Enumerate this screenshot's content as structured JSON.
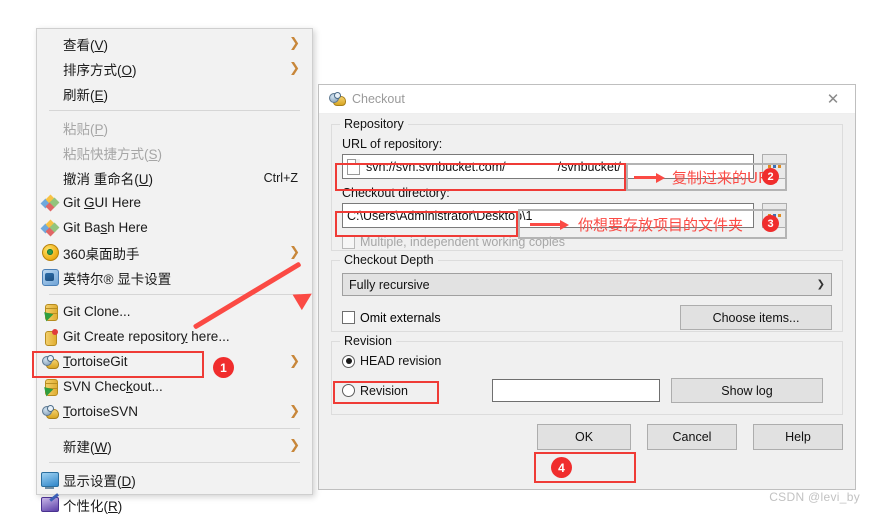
{
  "context_menu": {
    "items": [
      {
        "label": "查看(V)",
        "accel": "",
        "icon": "none",
        "submenu": true,
        "disabled": false,
        "key": "V"
      },
      {
        "label": "排序方式(O)",
        "accel": "",
        "icon": "none",
        "submenu": true,
        "disabled": false,
        "key": "O"
      },
      {
        "label": "刷新(E)",
        "accel": "",
        "icon": "none",
        "submenu": false,
        "disabled": false,
        "key": "E"
      },
      {
        "separator": true
      },
      {
        "label": "粘贴(P)",
        "accel": "",
        "icon": "none",
        "submenu": false,
        "disabled": true,
        "key": "P"
      },
      {
        "label": "粘贴快捷方式(S)",
        "accel": "",
        "icon": "none",
        "submenu": false,
        "disabled": true,
        "key": "S"
      },
      {
        "label": "撤消 重命名(U)",
        "accel": "Ctrl+Z",
        "icon": "none",
        "submenu": false,
        "disabled": false,
        "key": "U"
      },
      {
        "label": "Git GUI Here",
        "accel": "",
        "icon": "git-diamonds-icon",
        "submenu": false,
        "disabled": false,
        "key": "G"
      },
      {
        "label": "Git Bash Here",
        "accel": "",
        "icon": "git-diamonds-icon",
        "submenu": false,
        "disabled": false,
        "key": "s"
      },
      {
        "label": "360桌面助手",
        "accel": "",
        "icon": "360-assistant-icon",
        "submenu": true,
        "disabled": false,
        "key": ""
      },
      {
        "label": "英特尔® 显卡设置",
        "accel": "",
        "icon": "intel-graphics-icon",
        "submenu": false,
        "disabled": false,
        "key": ""
      },
      {
        "separator": true
      },
      {
        "label": "Git Clone...",
        "accel": "",
        "icon": "git-clone-icon",
        "submenu": false,
        "disabled": false,
        "key": ""
      },
      {
        "label": "Git Create repository here...",
        "accel": "",
        "icon": "git-create-repo-icon",
        "submenu": false,
        "disabled": false,
        "key": "y"
      },
      {
        "label": "TortoiseGit",
        "accel": "",
        "icon": "tortoise-git-icon",
        "submenu": true,
        "disabled": false,
        "key": "T"
      },
      {
        "label": "SVN Checkout...",
        "accel": "",
        "icon": "svn-checkout-icon",
        "submenu": false,
        "disabled": false,
        "key": "k",
        "highlighted": true
      },
      {
        "label": "TortoiseSVN",
        "accel": "",
        "icon": "tortoise-svn-icon",
        "submenu": true,
        "disabled": false,
        "key": "T"
      },
      {
        "separator": true
      },
      {
        "label": "新建(W)",
        "accel": "",
        "icon": "none",
        "submenu": true,
        "disabled": false,
        "key": "W"
      },
      {
        "separator": true
      },
      {
        "label": "显示设置(D)",
        "accel": "",
        "icon": "display-settings-icon",
        "submenu": false,
        "disabled": false,
        "key": "D"
      },
      {
        "label": "个性化(R)",
        "accel": "",
        "icon": "personalize-icon",
        "submenu": false,
        "disabled": false,
        "key": "R"
      }
    ]
  },
  "dialog": {
    "title": "Checkout",
    "close_label": "✕",
    "repository": {
      "group_title": "Repository",
      "url_label": "URL of repository:",
      "url_value_prefix": "svn://svn.svnbucket.com/",
      "url_value_suffix": "/svnbucket/",
      "browse_label": "...",
      "directory_label": "Checkout directory:",
      "directory_value": "C:\\Users\\Administrator\\Desktop\\1",
      "multiple_copies_label": "Multiple, independent working copies",
      "multiple_copies_checked": false,
      "multiple_copies_disabled": true
    },
    "checkout_depth": {
      "group_title": "Checkout Depth",
      "selected": "Fully recursive",
      "options": [
        "Fully recursive"
      ],
      "omit_externals_label": "Omit externals",
      "omit_externals_checked": false,
      "choose_items_label": "Choose items..."
    },
    "revision": {
      "group_title": "Revision",
      "head_label": "HEAD revision",
      "head_selected": true,
      "revision_label": "Revision",
      "revision_selected": false,
      "revision_value": "",
      "show_log_label": "Show log"
    },
    "buttons": {
      "ok": "OK",
      "cancel": "Cancel",
      "help": "Help"
    }
  },
  "annotations": {
    "badge1": "1",
    "badge2": "2",
    "badge3": "3",
    "badge4": "4",
    "note_url": "复制过来的URL",
    "note_directory": "你想要存放项目的文件夹"
  },
  "watermark": "CSDN @levi_by",
  "colors": {
    "accent_red": "#fb4a44",
    "badge_red": "#f02d2d",
    "highlight_red": "#ef3b36",
    "dialog_bg": "#f0f0f0",
    "menu_bg": "#f2f2f2"
  }
}
